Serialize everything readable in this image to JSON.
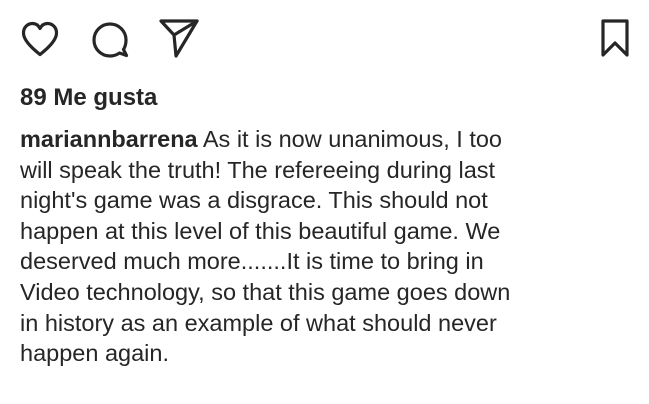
{
  "post": {
    "actions": {
      "like_icon": "heart-outline",
      "comment_icon": "speech-bubble-outline",
      "share_icon": "paper-plane-outline",
      "save_icon": "bookmark-outline"
    },
    "likes_text": "89 Me gusta",
    "caption": {
      "username": "mariannbarrena",
      "first_line_rest": " As it is now unanimous, I too",
      "lines": [
        "will speak the truth! The refereeing during last",
        "night's game was a disgrace. This should not",
        "happen at this level of this beautiful game. We",
        "deserved much more.......It is time to bring in",
        "Video technology, so that this game goes down",
        "in history as an example of what should never",
        "happen again."
      ]
    }
  },
  "colors": {
    "text": "#262626",
    "background": "#ffffff"
  }
}
